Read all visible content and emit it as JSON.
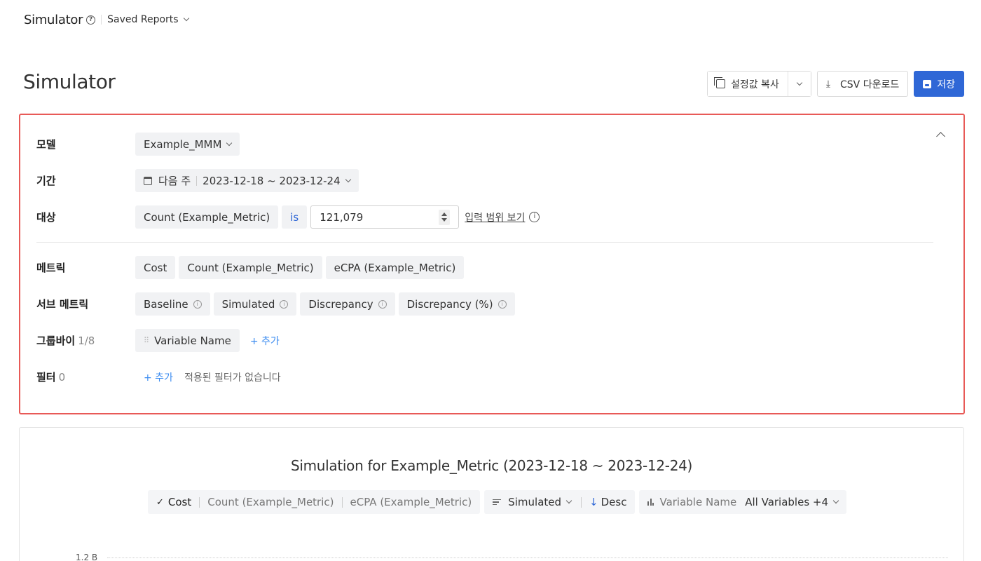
{
  "breadcrumb": {
    "title": "Simulator",
    "help": "?",
    "saved_reports": "Saved Reports"
  },
  "page": {
    "title": "Simulator"
  },
  "toolbar": {
    "copy_settings": "설정값 복사",
    "csv_download": "CSV 다운로드",
    "save": "저장"
  },
  "settings": {
    "model": {
      "label": "모델",
      "value": "Example_MMM"
    },
    "period": {
      "label": "기간",
      "preset": "다음 주",
      "range": "2023-12-18 ~ 2023-12-24"
    },
    "target": {
      "label": "대상",
      "metric": "Count (Example_Metric)",
      "operator": "is",
      "value": "121,079",
      "range_link": "입력 범위 보기"
    },
    "metrics": {
      "label": "메트릭",
      "items": [
        "Cost",
        "Count (Example_Metric)",
        "eCPA (Example_Metric)"
      ]
    },
    "sub_metrics": {
      "label": "서브 메트릭",
      "items": [
        "Baseline",
        "Simulated",
        "Discrepancy",
        "Discrepancy (%)"
      ]
    },
    "group_by": {
      "label": "그룹바이",
      "count": "1/8",
      "item": "Variable Name",
      "add": "+ 추가"
    },
    "filter": {
      "label": "필터",
      "count": "0",
      "add": "+ 추가",
      "empty": "적용된 필터가 없습니다"
    }
  },
  "chart": {
    "title": "Simulation for Example_Metric (2023-12-18 ~ 2023-12-24)",
    "metric_tabs": [
      "Cost",
      "Count (Example_Metric)",
      "eCPA (Example_Metric)"
    ],
    "sort_by": "Simulated",
    "sort_order": "Desc",
    "variable_label": "Variable Name",
    "variable_value": "All Variables +4",
    "y_tick_top": "1.2 B"
  },
  "colors": {
    "primary": "#2f67d6",
    "highlight_border": "#e85a57",
    "link": "#3c8cf0"
  }
}
